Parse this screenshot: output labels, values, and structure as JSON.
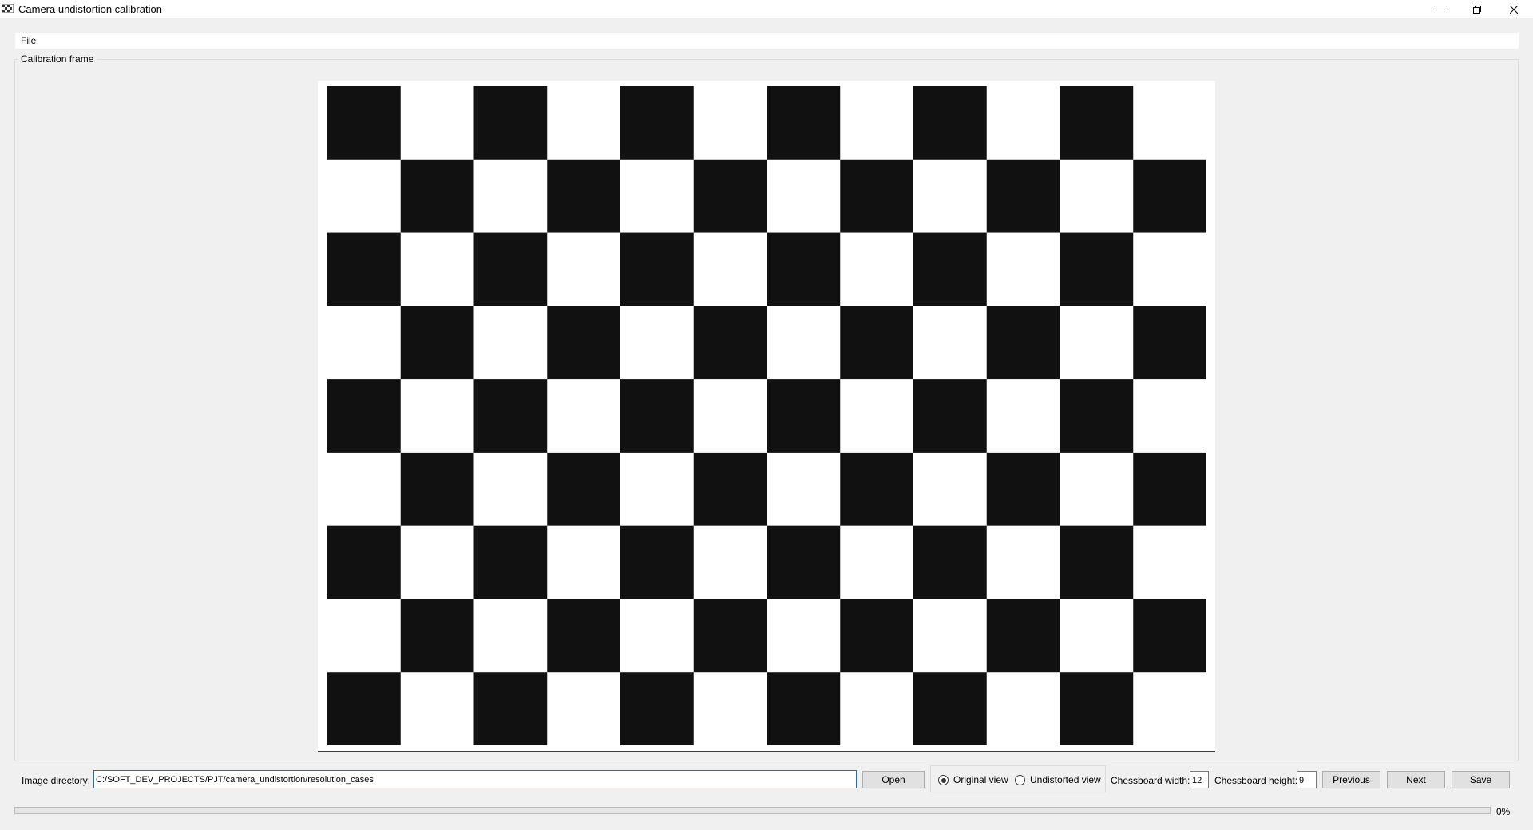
{
  "window": {
    "title": "Camera undistortion calibration",
    "app_icon": "chessboard-app-icon",
    "controls": [
      "minimize-icon",
      "restore-icon",
      "close-icon"
    ]
  },
  "menubar": {
    "items": [
      {
        "label": "File"
      }
    ]
  },
  "calibration_frame": {
    "title": "Calibration frame",
    "chessboard": {
      "columns": 12,
      "rows": 9,
      "dark_color": "#111111",
      "light_color": "#ffffff"
    }
  },
  "controls": {
    "image_directory_label": "Image directory:",
    "image_directory_value": "C:/SOFT_DEV_PROJECTS/PJT/camera_undistortion/resolution_cases",
    "open_label": "Open",
    "view_options": [
      {
        "label": "Original view",
        "checked": true
      },
      {
        "label": "Undistorted view",
        "checked": false
      }
    ],
    "chessboard_width_label": "Chessboard width:",
    "chessboard_width_value": "12",
    "chessboard_height_label": "Chessboard height:",
    "chessboard_height_value": "9",
    "previous_label": "Previous",
    "next_label": "Next",
    "save_label": "Save"
  },
  "progress": {
    "value": 0,
    "text": "0%"
  },
  "colors": {
    "window_bg": "#f0f0f0",
    "focus_border": "#0078d7",
    "progress_fill": "#06b025"
  }
}
